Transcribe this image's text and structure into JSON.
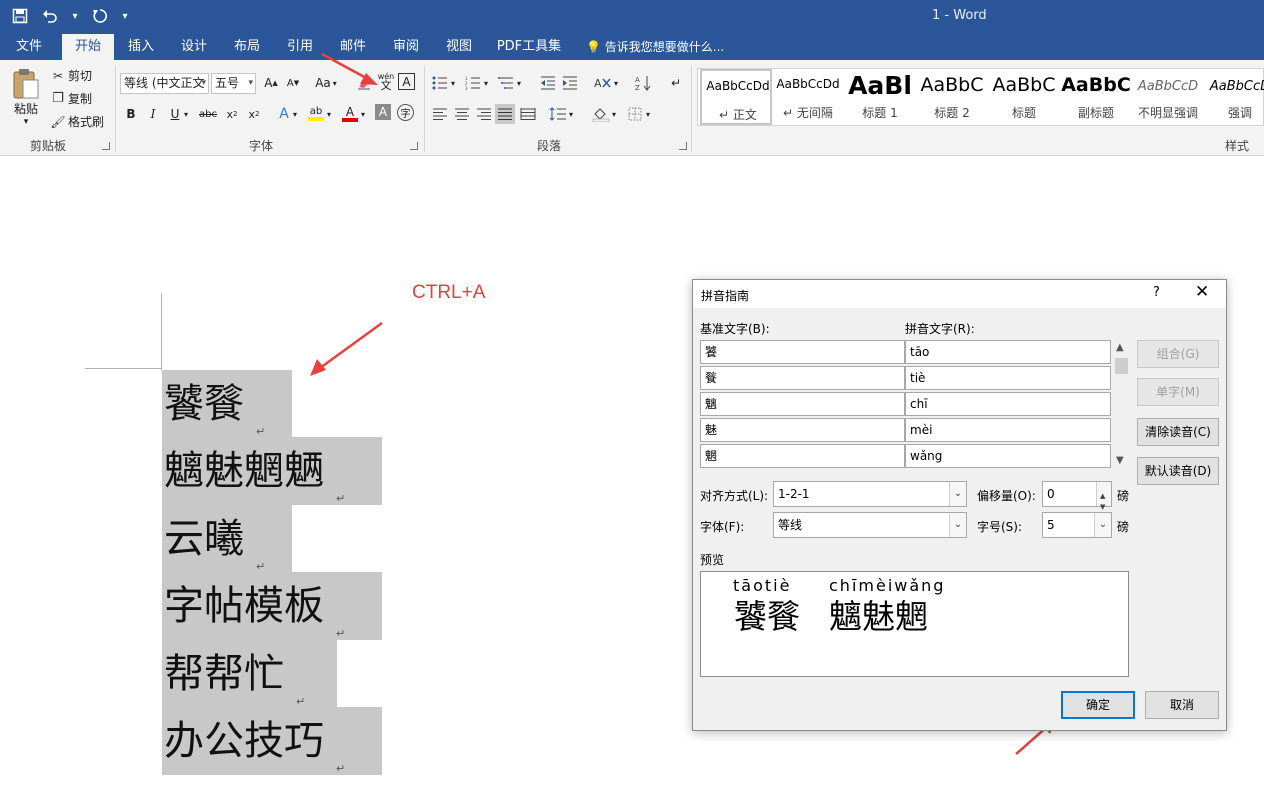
{
  "window": {
    "title": "1 - Word"
  },
  "quick_access": {
    "save_icon": "save-icon",
    "undo_icon": "undo-icon",
    "redo_icon": "redo-icon",
    "customize_icon": "customize-icon"
  },
  "tabs": [
    {
      "label": "文件"
    },
    {
      "label": "开始"
    },
    {
      "label": "插入"
    },
    {
      "label": "设计"
    },
    {
      "label": "布局"
    },
    {
      "label": "引用"
    },
    {
      "label": "邮件"
    },
    {
      "label": "审阅"
    },
    {
      "label": "视图"
    },
    {
      "label": "PDF工具集"
    }
  ],
  "tell_me": "告诉我您想要做什么...",
  "clipboard": {
    "paste": "粘贴",
    "cut": "剪切",
    "copy": "复制",
    "format_painter": "格式刷",
    "group": "剪贴板"
  },
  "font": {
    "name": "等线 (中文正文",
    "size": "五号",
    "case": "Aa",
    "group": "字体",
    "phonetic_top": "wén",
    "phonetic_bottom": "文",
    "char_border": "A"
  },
  "paragraph": {
    "group": "段落"
  },
  "styles": {
    "group": "样式",
    "items": [
      {
        "sample": "AaBbCcDd",
        "name": "正文"
      },
      {
        "sample": "AaBbCcDd",
        "name": "无间隔"
      },
      {
        "sample": "AaBl",
        "name": "标题 1"
      },
      {
        "sample": "AaBbC",
        "name": "标题 2"
      },
      {
        "sample": "AaBbC",
        "name": "标题"
      },
      {
        "sample": "AaBbC",
        "name": "副标题"
      },
      {
        "sample": "AaBbCcD",
        "name": "不明显强调"
      },
      {
        "sample": "AaBbCcD",
        "name": "强调"
      }
    ]
  },
  "document": {
    "lines": [
      "饕餮",
      "魑魅魍魉",
      "云曦",
      "字帖模板",
      "帮帮忙",
      "办公技巧"
    ],
    "annotation": "CTRL+A"
  },
  "dialog": {
    "title": "拼音指南",
    "help": "?",
    "base_label": "基准文字(B):",
    "pinyin_label": "拼音文字(R):",
    "rows": [
      {
        "base": "饕",
        "pinyin": "tāo"
      },
      {
        "base": "餮",
        "pinyin": "tiè"
      },
      {
        "base": "魑",
        "pinyin": "chī"
      },
      {
        "base": "魅",
        "pinyin": "mèi"
      },
      {
        "base": "魍",
        "pinyin": "wǎng"
      }
    ],
    "buttons": {
      "group": "组合(G)",
      "single": "单字(M)",
      "clear": "清除读音(C)",
      "default": "默认读音(D)",
      "ok": "确定",
      "cancel": "取消"
    },
    "align_label": "对齐方式(L):",
    "align_value": "1-2-1",
    "offset_label": "偏移量(O):",
    "offset_value": "0",
    "offset_unit": "磅",
    "font_label": "字体(F):",
    "font_value": "等线",
    "size_label": "字号(S):",
    "size_value": "5",
    "size_unit": "磅",
    "preview_label": "预览",
    "preview": {
      "pinyin1": "tāotiè",
      "hanzi1": "饕餮",
      "pinyin2": "chīmèiwǎng",
      "hanzi2": "魑魅魍"
    }
  }
}
